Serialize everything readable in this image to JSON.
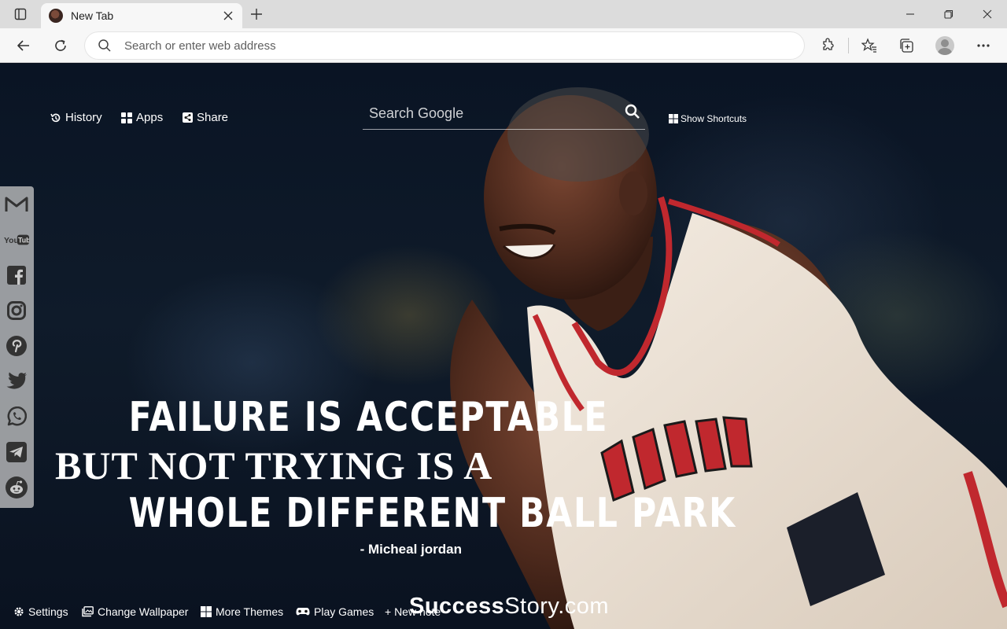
{
  "browser": {
    "tab": {
      "title": "New Tab"
    },
    "address_bar": {
      "placeholder": "Search or enter web address",
      "value": ""
    },
    "icons": [
      "tab-actions-icon",
      "close-icon",
      "plus-icon",
      "minimize-icon",
      "restore-icon",
      "window-close-icon",
      "back-arrow-icon",
      "refresh-icon",
      "search-icon",
      "extensions-icon",
      "favorites-icon",
      "collections-icon",
      "profile-icon",
      "more-icon"
    ]
  },
  "topnav": {
    "history": "History",
    "apps": "Apps",
    "share": "Share",
    "search_placeholder": "Search Google",
    "show_shortcuts": "Show Shortcuts"
  },
  "social": [
    "gmail",
    "youtube",
    "facebook",
    "instagram",
    "pinterest",
    "twitter",
    "whatsapp",
    "telegram",
    "reddit"
  ],
  "quote": {
    "line1": "FAILURE IS ACCEPTABLE",
    "line2": "BUT NOT TRYING IS A",
    "line3": "WHOLE DIFFERENT BALL PARK",
    "author": "- Micheal jordan"
  },
  "bottom": {
    "settings": "Settings",
    "change_wallpaper": "Change Wallpaper",
    "more_themes": "More Themes",
    "play_games": "Play Games",
    "new_note": "+ New note"
  },
  "brand": {
    "part1": "Success",
    "part2": "Story.com"
  },
  "colors": {
    "jersey_red": "#c0282e",
    "jersey_white": "#efe7dc",
    "skin": "#5a3324",
    "wallpaper_dark": "#0b1424"
  }
}
